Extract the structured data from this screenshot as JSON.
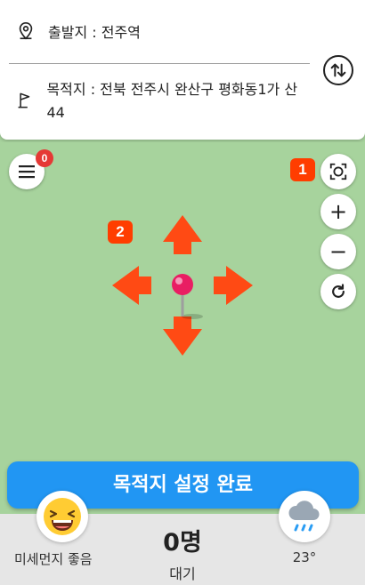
{
  "route": {
    "origin_text": "출발지 : 전주역",
    "dest_text": "목적지 : 전북 전주시 완산구 평화동1가 산 44"
  },
  "map": {
    "menu_badge_count": "0",
    "tag_one": "1",
    "tag_two": "2",
    "zoom_in_label": "+",
    "zoom_out_label": "−",
    "arrow_color": "#ff4a14",
    "pin_color": "#e91e63"
  },
  "confirm": {
    "label": "목적지 설정 완료"
  },
  "status": {
    "dust_label": "미세먼지 좋음",
    "count": "0명",
    "wait_label": "대기",
    "temperature": "23°"
  },
  "icons": {
    "origin": "location-pin-icon",
    "destination": "flag-icon",
    "swap": "swap-vertical-icon",
    "menu": "hamburger-menu-icon",
    "locate": "my-location-icon",
    "refresh": "refresh-icon",
    "dust": "laughing-face-icon",
    "weather": "rain-cloud-icon"
  }
}
